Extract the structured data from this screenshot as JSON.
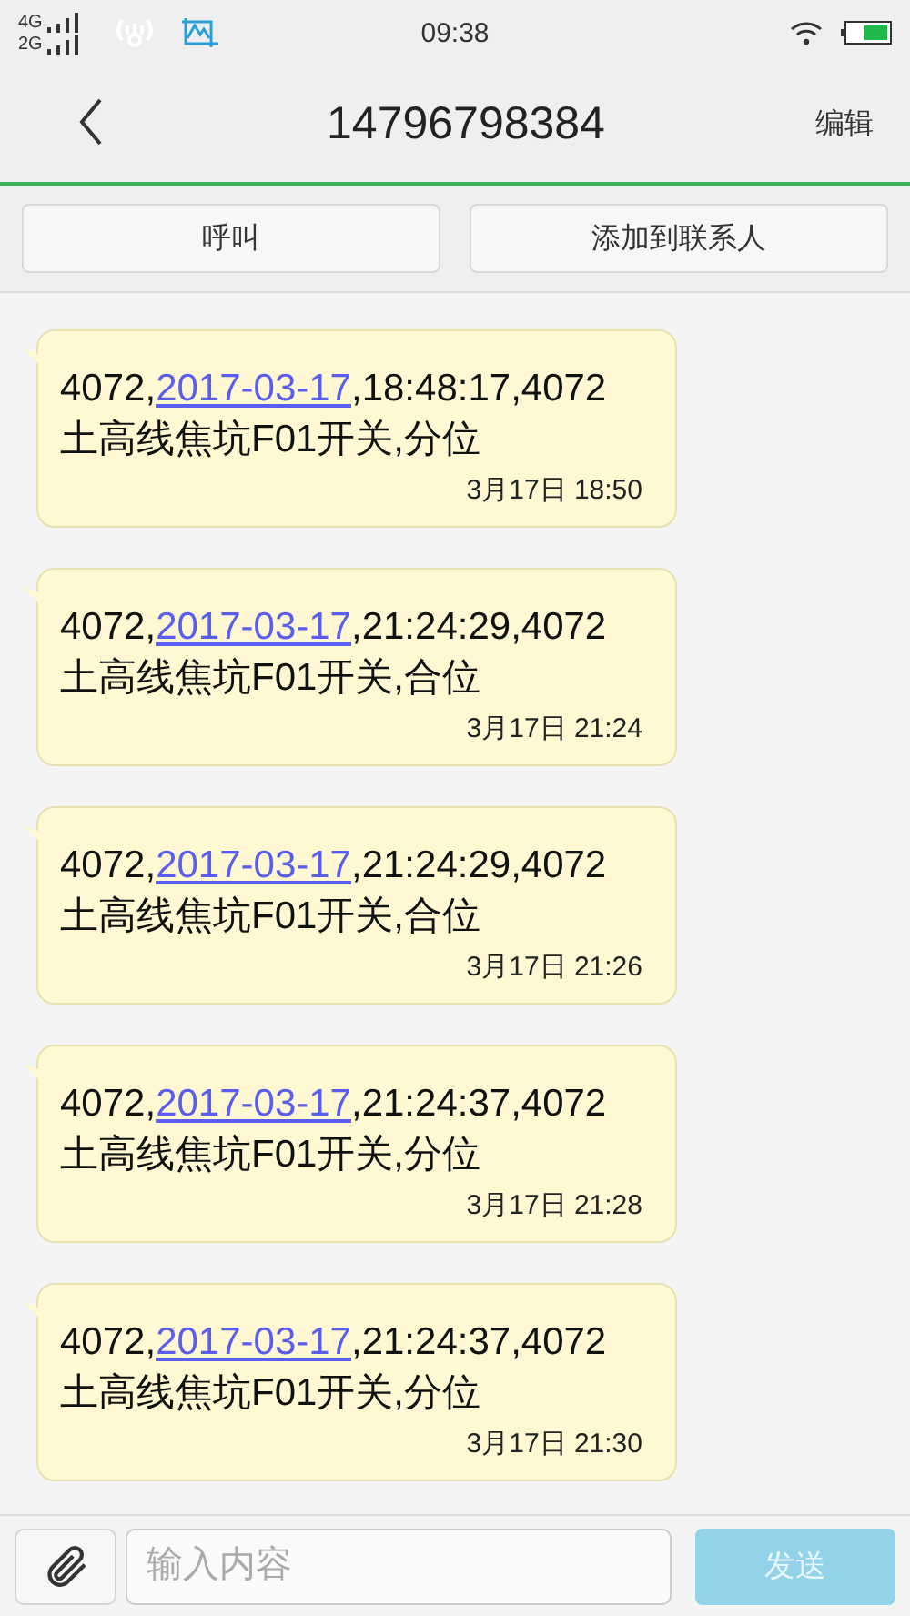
{
  "status_bar": {
    "network_1": "4G",
    "network_2": "2G",
    "time": "09:38"
  },
  "header": {
    "title": "14796798384",
    "edit": "编辑"
  },
  "actions": [
    "呼叫",
    "添加到联系人"
  ],
  "messages": [
    {
      "prefix": "4072,",
      "link": "2017-03-17",
      "suffix": ",18:48:17,4072",
      "line_2": "土高线焦坑F01开关,分位",
      "time": "3月17日 18:50"
    },
    {
      "prefix": "4072,",
      "link": "2017-03-17",
      "suffix": ",21:24:29,4072",
      "line_2": "土高线焦坑F01开关,合位",
      "time": "3月17日 21:24"
    },
    {
      "prefix": "4072,",
      "link": "2017-03-17",
      "suffix": ",21:24:29,4072",
      "line_2": "土高线焦坑F01开关,合位",
      "time": "3月17日 21:26"
    },
    {
      "prefix": "4072,",
      "link": "2017-03-17",
      "suffix": ",21:24:37,4072",
      "line_2": "土高线焦坑F01开关,分位",
      "time": "3月17日 21:28"
    },
    {
      "prefix": "4072,",
      "link": "2017-03-17",
      "suffix": ",21:24:37,4072",
      "line_2": "土高线焦坑F01开关,分位",
      "time": "3月17日 21:30"
    }
  ],
  "composer": {
    "placeholder": "输入内容",
    "send": "发送",
    "send_disabled": true
  }
}
